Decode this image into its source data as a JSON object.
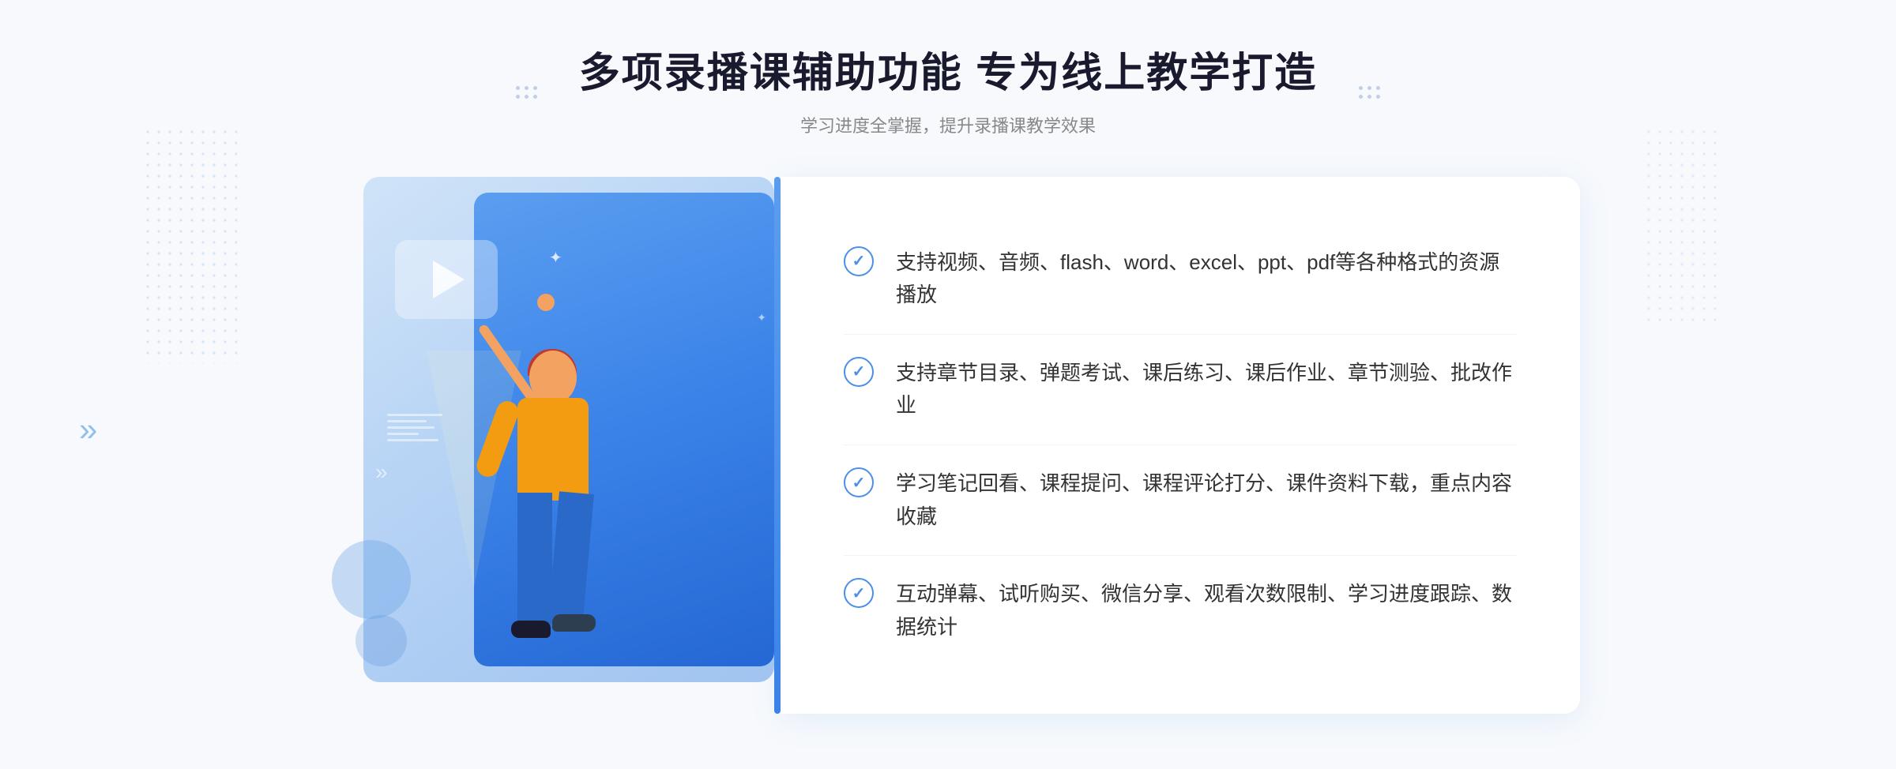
{
  "page": {
    "background_color": "#f7f9fc"
  },
  "header": {
    "title": "多项录播课辅助功能 专为线上教学打造",
    "subtitle": "学习进度全掌握，提升录播课教学效果",
    "deco_left_label": "header-deco-left",
    "deco_right_label": "header-deco-right"
  },
  "features": [
    {
      "id": 1,
      "text": "支持视频、音频、flash、word、excel、ppt、pdf等各种格式的资源播放"
    },
    {
      "id": 2,
      "text": "支持章节目录、弹题考试、课后练习、课后作业、章节测验、批改作业"
    },
    {
      "id": 3,
      "text": "学习笔记回看、课程提问、课程评论打分、课件资料下载，重点内容收藏"
    },
    {
      "id": 4,
      "text": "互动弹幕、试听购买、微信分享、观看次数限制、学习进度跟踪、数据统计"
    }
  ],
  "icons": {
    "check": "✓",
    "play": "▶",
    "chevron_double": "»",
    "star": "✦"
  },
  "colors": {
    "primary_blue": "#3a82e8",
    "light_blue": "#d0e4f8",
    "text_dark": "#1a1a2e",
    "text_gray": "#888888",
    "text_body": "#333333",
    "accent_orange": "#f39c12",
    "accent_red": "#c0392b"
  }
}
